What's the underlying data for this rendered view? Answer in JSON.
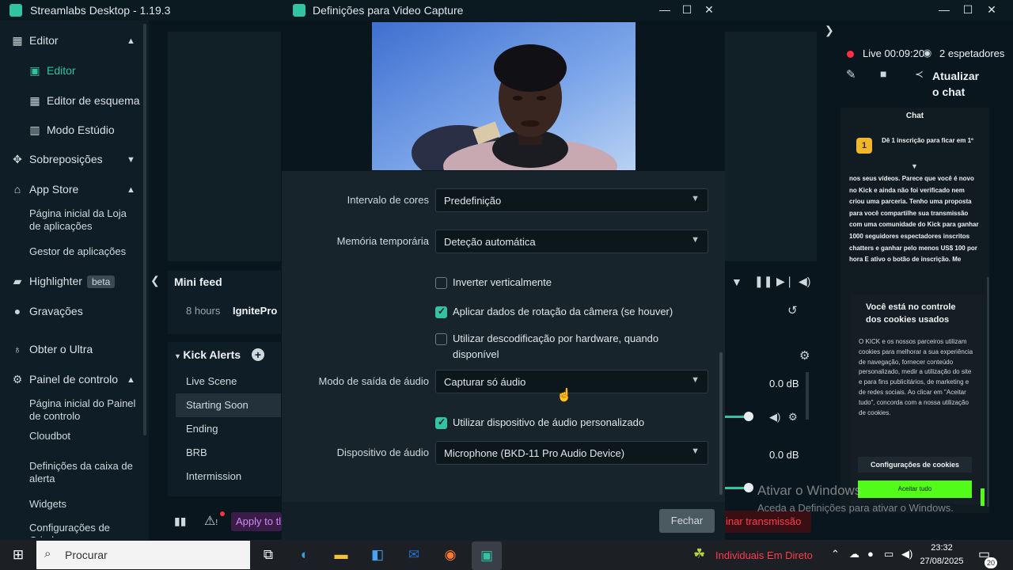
{
  "app": {
    "title": "Streamlabs Desktop - 1.19.3"
  },
  "sidebar": {
    "editor_group": "Editor",
    "editor": "Editor",
    "layout_editor": "Editor de esquema",
    "studio_mode": "Modo Estúdio",
    "overlays": "Sobreposições",
    "app_store": "App Store",
    "app_store_home": "Página inicial da Loja de aplicações",
    "app_manager": "Gestor de aplicações",
    "highlighter": "Highlighter",
    "highlighter_badge": "beta",
    "recordings": "Gravações",
    "ultra": "Obter o Ultra",
    "dashboard": "Painel de controlo",
    "dashboard_home": "Página inicial do Painel de controlo",
    "cloudbot": "Cloudbot",
    "alertbox": "Definições da caixa de alerta",
    "widgets": "Widgets",
    "script_settings": "Configurações de Criador"
  },
  "editor": {
    "minifeed_title": "Mini feed",
    "feed_time": "8 hours",
    "feed_user": "IgnitePro",
    "scene_collection": "Kick Alerts",
    "scenes": [
      "Live Scene",
      "Starting Soon",
      "Ending",
      "BRB",
      "Intermission"
    ],
    "mixer_db1": "0.0 dB",
    "mixer_db2": "0.0 dB",
    "apply_button": "Apply to tl",
    "end_stream": "inar transmissão"
  },
  "live": {
    "status": "Live 00:09:20",
    "viewers": "2 espetadores",
    "refresh": "Atualizar o chat"
  },
  "chat": {
    "header": "Chat",
    "promo": "Dê 1 inscrição para ficar em 1º",
    "message": "nos seus vídeos. Parece que você é novo no Kick e ainda não foi verificado nem criou uma parceria. Tenho uma proposta para você compartilhe sua transmissão com uma comunidade do Kick para ganhar 1000 seguidores espectadores inscritos chatters e ganhar pelo menos US$ 100 por hora E ativo o botão de inscrição. Me",
    "cookie_title": "Você está no controle dos cookies usados",
    "cookie_text": "O KICK e os nossos parceiros utilizam cookies para melhorar a sua experiência de navegação, fornecer conteúdo personalizado, medir a utilização do site e para fins publicitários, de marketing e de redes sociais. Ao clicar em \"Aceitar tudo\", concorda com a nossa utilização de cookies.",
    "cookie_settings": "Configurações de cookies",
    "cookie_accept": "Aceitar tudo"
  },
  "dialog": {
    "title": "Definições para Video Capture",
    "color_range_label": "Intervalo de cores",
    "color_range_value": "Predefinição",
    "buffer_label": "Memória temporária",
    "buffer_value": "Deteção automática",
    "flip_vertical": "Inverter verticalmente",
    "apply_rotation": "Aplicar dados de rotação da câmera (se houver)",
    "hw_decode": "Utilizar descodificação por hardware, quando disponível",
    "audio_output_label": "Modo de saída de áudio",
    "audio_output_value": "Capturar só áudio",
    "custom_audio": "Utilizar dispositivo de áudio personalizado",
    "audio_device_label": "Dispositivo de áudio",
    "audio_device_value": "Microphone (BKD-11 Pro Audio Device)",
    "close": "Fechar"
  },
  "watermark": {
    "line1": "Ativar o Windows",
    "line2": "Aceda a Definições para ativar o Windows."
  },
  "taskbar": {
    "search": "Procurar",
    "live_label": "Individuais Em Direto",
    "time": "23:32",
    "date": "27/08/2025",
    "notif_count": "20"
  },
  "colors": {
    "accent": "#31c3a2",
    "live_red": "#ff2f44",
    "kick_green": "#53fc18"
  }
}
